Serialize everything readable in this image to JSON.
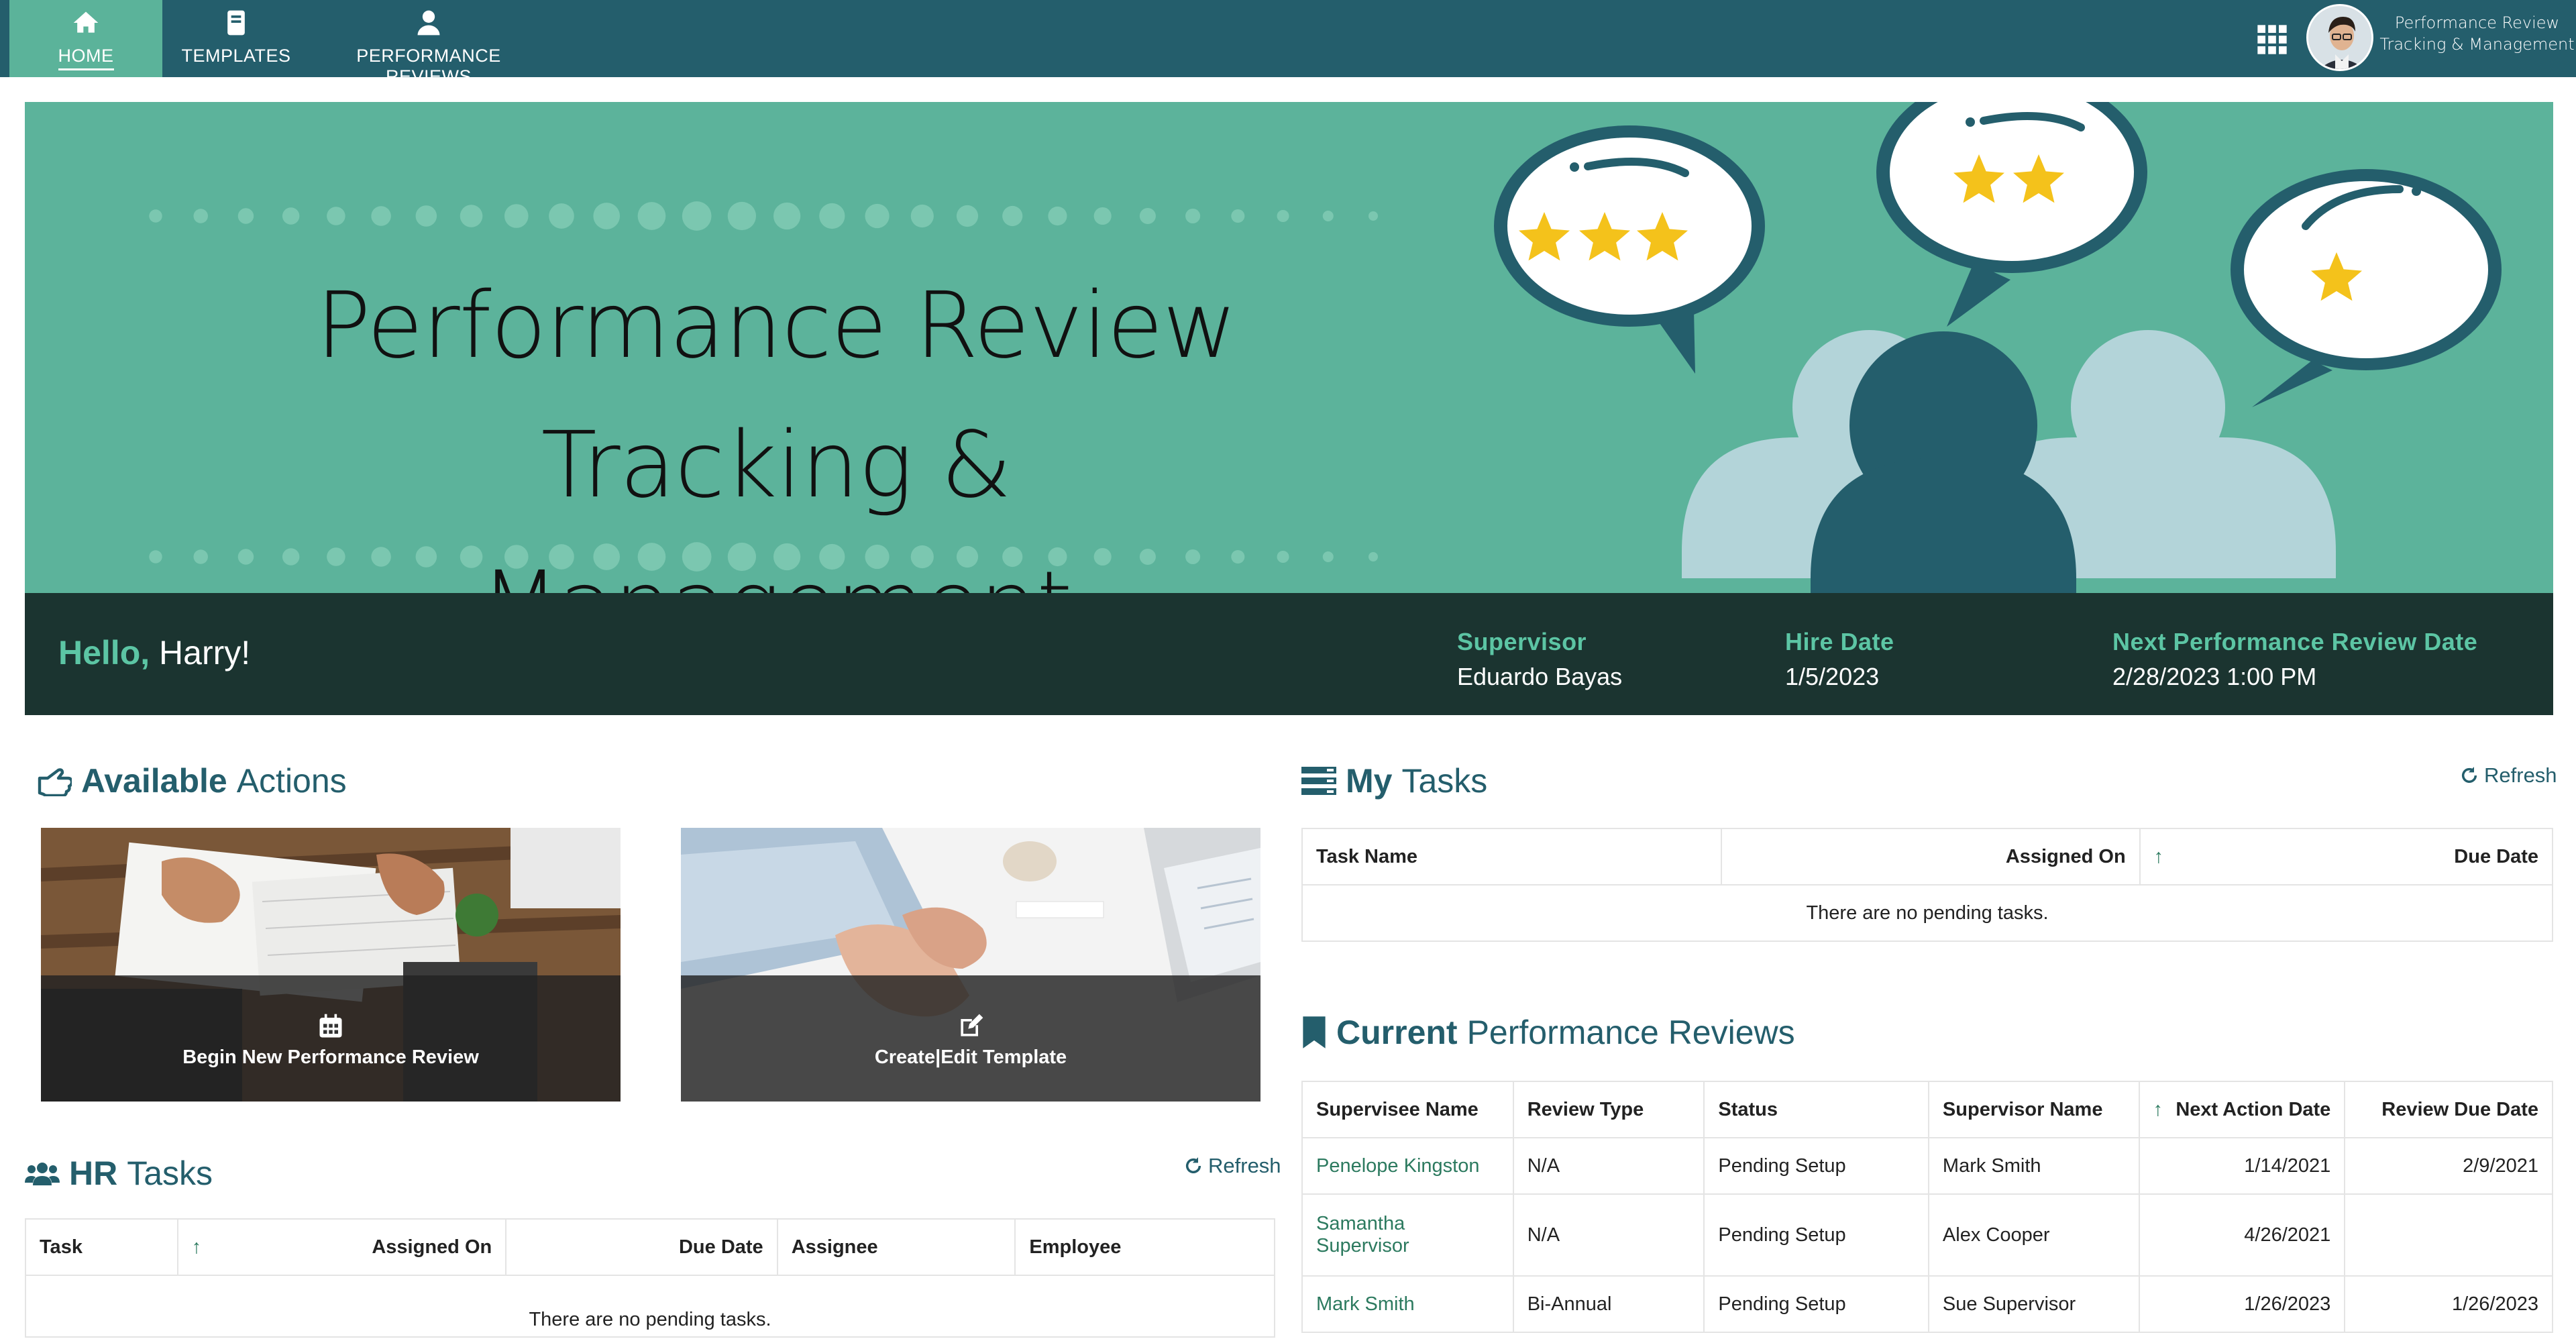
{
  "nav": {
    "items": [
      {
        "label": "HOME",
        "icon": "home-icon",
        "active": true
      },
      {
        "label": "TEMPLATES",
        "icon": "book-icon"
      },
      {
        "label": "PERFORMANCE REVIEWS",
        "icon": "user-icon"
      }
    ],
    "apps_icon": "grid-icon",
    "brand_line1": "Performance Review",
    "brand_line2": "Tracking & Management"
  },
  "hero": {
    "title_line1": "Performance Review Tracking &",
    "title_line2": "Management"
  },
  "welcome": {
    "greeting": "Hello,",
    "name": "Harry!",
    "supervisor_label": "Supervisor",
    "supervisor_value": "Eduardo Bayas",
    "hire_label": "Hire Date",
    "hire_value": "1/5/2023",
    "next_label": "Next Performance Review Date",
    "next_value": "2/28/2023 1:00 PM"
  },
  "available_actions": {
    "title_bold": "Available",
    "title_rest": "Actions",
    "cards": [
      {
        "label": "Begin New Performance Review",
        "icon": "calendar-icon"
      },
      {
        "label": "Create|Edit Template",
        "icon": "edit-icon"
      }
    ]
  },
  "my_tasks": {
    "title_bold": "My",
    "title_rest": "Tasks",
    "refresh": "Refresh",
    "columns": [
      "Task Name",
      "Assigned On",
      "Due Date"
    ],
    "sort_indicator": "↑",
    "empty": "There are no pending tasks."
  },
  "current_reviews": {
    "title_bold": "Current",
    "title_rest": "Performance Reviews",
    "columns": [
      "Supervisee Name",
      "Review Type",
      "Status",
      "Supervisor Name",
      "Next Action Date",
      "Review Due Date"
    ],
    "sort_indicator": "↑",
    "rows": [
      {
        "supervisee": "Penelope Kingston",
        "type": "N/A",
        "status": "Pending Setup",
        "supervisor": "Mark Smith",
        "next_action": "1/14/2021",
        "due": "2/9/2021"
      },
      {
        "supervisee_l1": "Samantha",
        "supervisee_l2": "Supervisor",
        "type": "N/A",
        "status": "Pending Setup",
        "supervisor": "Alex Cooper",
        "next_action": "4/26/2021",
        "due": ""
      },
      {
        "supervisee": "Mark Smith",
        "type": "Bi-Annual",
        "status": "Pending Setup",
        "supervisor": "Sue Supervisor",
        "next_action": "1/26/2023",
        "due": "1/26/2023"
      }
    ]
  },
  "hr_tasks": {
    "title_bold": "HR",
    "title_rest": "Tasks",
    "refresh": "Refresh",
    "columns": [
      "Task",
      "Assigned On",
      "Due Date",
      "Assignee",
      "Employee"
    ],
    "sort_indicator": "↑",
    "empty": "There are no pending tasks."
  },
  "colors": {
    "nav_bg": "#245e6c",
    "accent": "#5bb39a",
    "dark_bar": "#1b3430",
    "link": "#2c7a5f",
    "star": "#f4c21b"
  }
}
